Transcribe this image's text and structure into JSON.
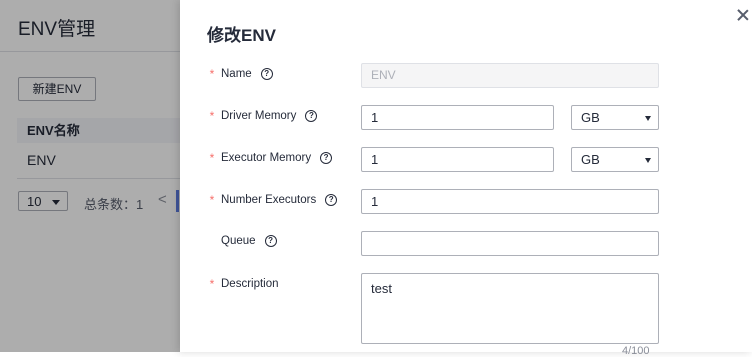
{
  "background": {
    "title": "ENV管理",
    "new_button": "新建ENV",
    "table": {
      "columns": [
        "ENV名称"
      ],
      "rows": [
        [
          "ENV"
        ]
      ]
    },
    "pagination": {
      "page_size": "10",
      "total_label": "总条数：1",
      "prev": "<"
    }
  },
  "panel": {
    "title": "修改ENV",
    "fields": {
      "name": {
        "label": "Name",
        "required": true,
        "value": "ENV",
        "disabled": true
      },
      "driver_memory": {
        "label": "Driver Memory",
        "required": true,
        "value": "1",
        "unit": "GB"
      },
      "executor_memory": {
        "label": "Executor Memory",
        "required": true,
        "value": "1",
        "unit": "GB"
      },
      "number_executors": {
        "label": "Number Executors",
        "required": true,
        "value": "1"
      },
      "queue": {
        "label": "Queue",
        "required": false,
        "value": ""
      },
      "description": {
        "label": "Description",
        "required": true,
        "value": "test",
        "counter": "4/100"
      }
    },
    "required_mark": "*",
    "help_glyph": "?"
  },
  "colors": {
    "required": "#f66f6a",
    "border": "#adb0b8",
    "text": "#252b3a",
    "overlay": "rgba(0,0,0,0.32)"
  },
  "icons": [
    "close-icon",
    "help-icon",
    "chevron-down-icon",
    "chevron-left-icon"
  ]
}
